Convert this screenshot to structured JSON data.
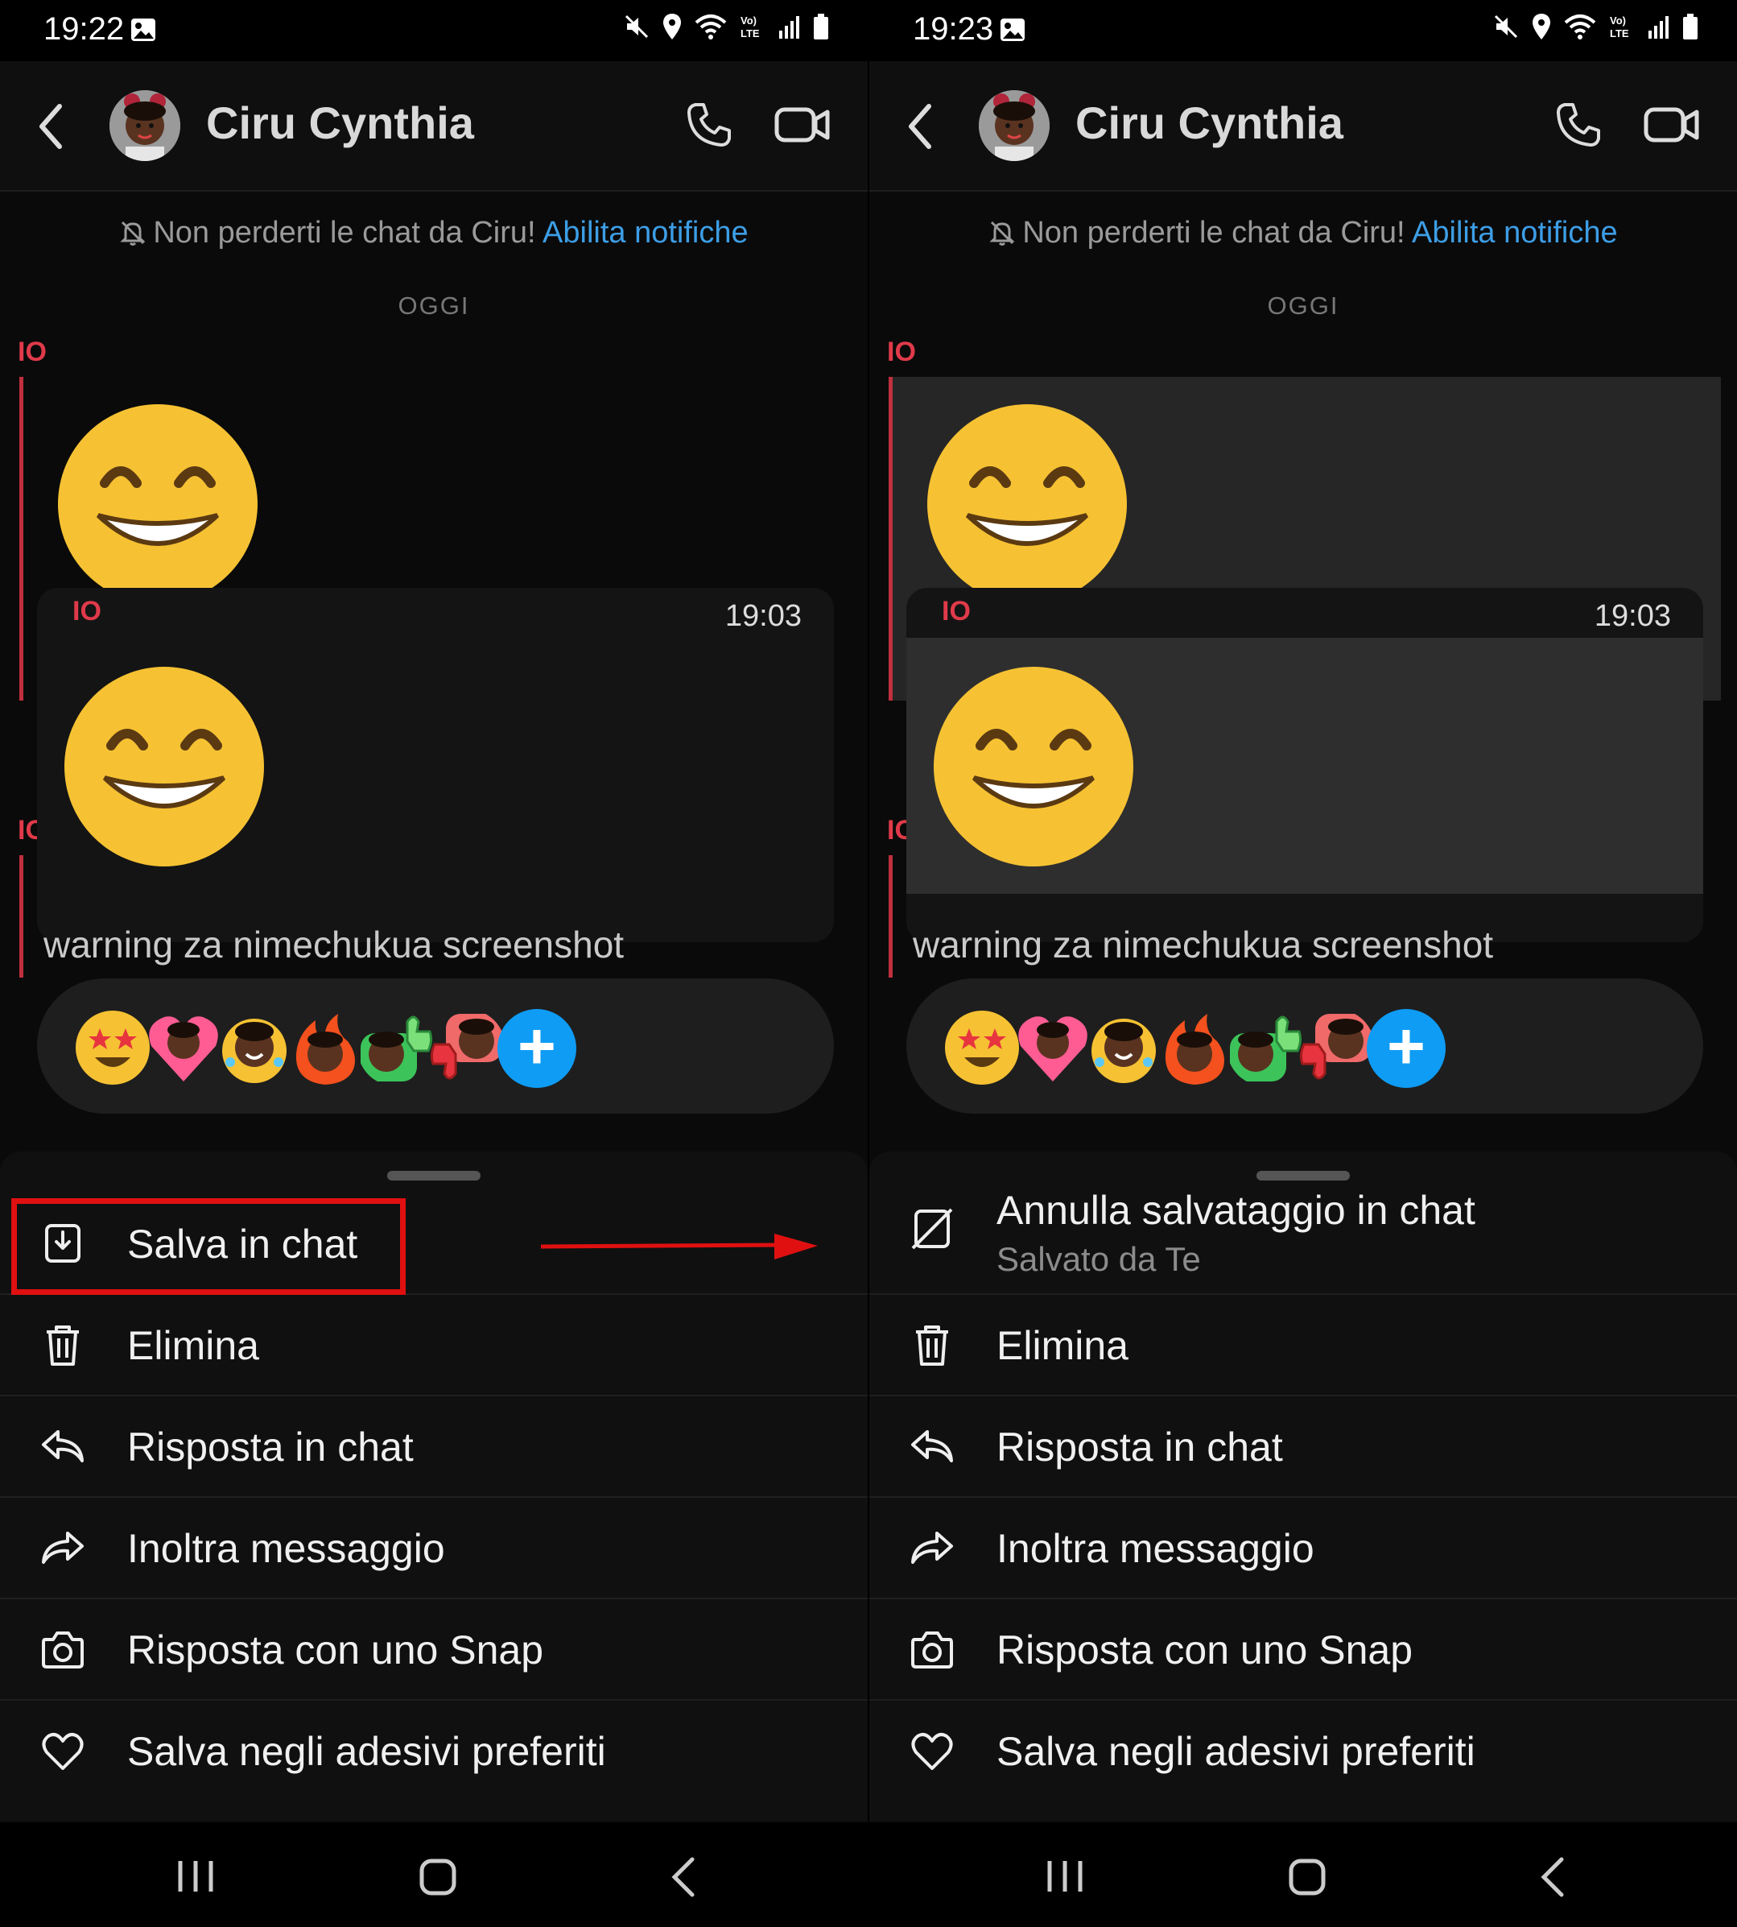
{
  "screens": [
    {
      "status": {
        "time": "19:22"
      },
      "header": {
        "contact_name": "Ciru Cynthia"
      },
      "notice": {
        "text": "Non perderti le chat da Ciru! ",
        "link": "Abilita notifiche"
      },
      "date_label": "OGGI",
      "sender_labels": {
        "first": "IO",
        "second": "IO"
      },
      "selected_message": {
        "sender": "IO",
        "time": "19:03",
        "saved": false
      },
      "behind_text": "warning za nimechukua screenshot",
      "reactions": [
        "star-struck-emoji",
        "heart-bitmoji",
        "laughing-bitmoji",
        "fire-bitmoji",
        "thumbs-up-bitmoji",
        "thumbs-down-bitmoji"
      ],
      "menu": [
        {
          "label": "Salva in chat",
          "sublabel": "",
          "icon": "save-in-chat-icon",
          "highlighted": true
        },
        {
          "label": "Elimina",
          "icon": "trash-icon"
        },
        {
          "label": "Risposta in chat",
          "icon": "reply-icon"
        },
        {
          "label": "Inoltra messaggio",
          "icon": "forward-icon"
        },
        {
          "label": "Risposta con uno Snap",
          "icon": "camera-icon"
        },
        {
          "label": "Salva negli adesivi preferiti",
          "icon": "heart-icon"
        }
      ]
    },
    {
      "status": {
        "time": "19:23"
      },
      "header": {
        "contact_name": "Ciru Cynthia"
      },
      "notice": {
        "text": "Non perderti le chat da Ciru! ",
        "link": "Abilita notifiche"
      },
      "date_label": "OGGI",
      "sender_labels": {
        "first": "IO",
        "second": "IO"
      },
      "selected_message": {
        "sender": "IO",
        "time": "19:03",
        "saved": true
      },
      "behind_text": "warning za nimechukua screenshot",
      "reactions": [
        "star-struck-emoji",
        "heart-bitmoji",
        "laughing-bitmoji",
        "fire-bitmoji",
        "thumbs-up-bitmoji",
        "thumbs-down-bitmoji"
      ],
      "menu": [
        {
          "label": "Annulla salvataggio in chat",
          "sublabel": "Salvato da Te",
          "icon": "unsave-icon"
        },
        {
          "label": "Elimina",
          "icon": "trash-icon"
        },
        {
          "label": "Risposta in chat",
          "icon": "reply-icon"
        },
        {
          "label": "Inoltra messaggio",
          "icon": "forward-icon"
        },
        {
          "label": "Risposta con uno Snap",
          "icon": "camera-icon"
        },
        {
          "label": "Salva negli adesivi preferiti",
          "icon": "heart-icon"
        }
      ]
    }
  ],
  "colors": {
    "accent_link": "#3d9ee6",
    "sender_red": "#e03a4a",
    "annotation_red": "#e01010",
    "plus_blue": "#0e9cf5"
  }
}
